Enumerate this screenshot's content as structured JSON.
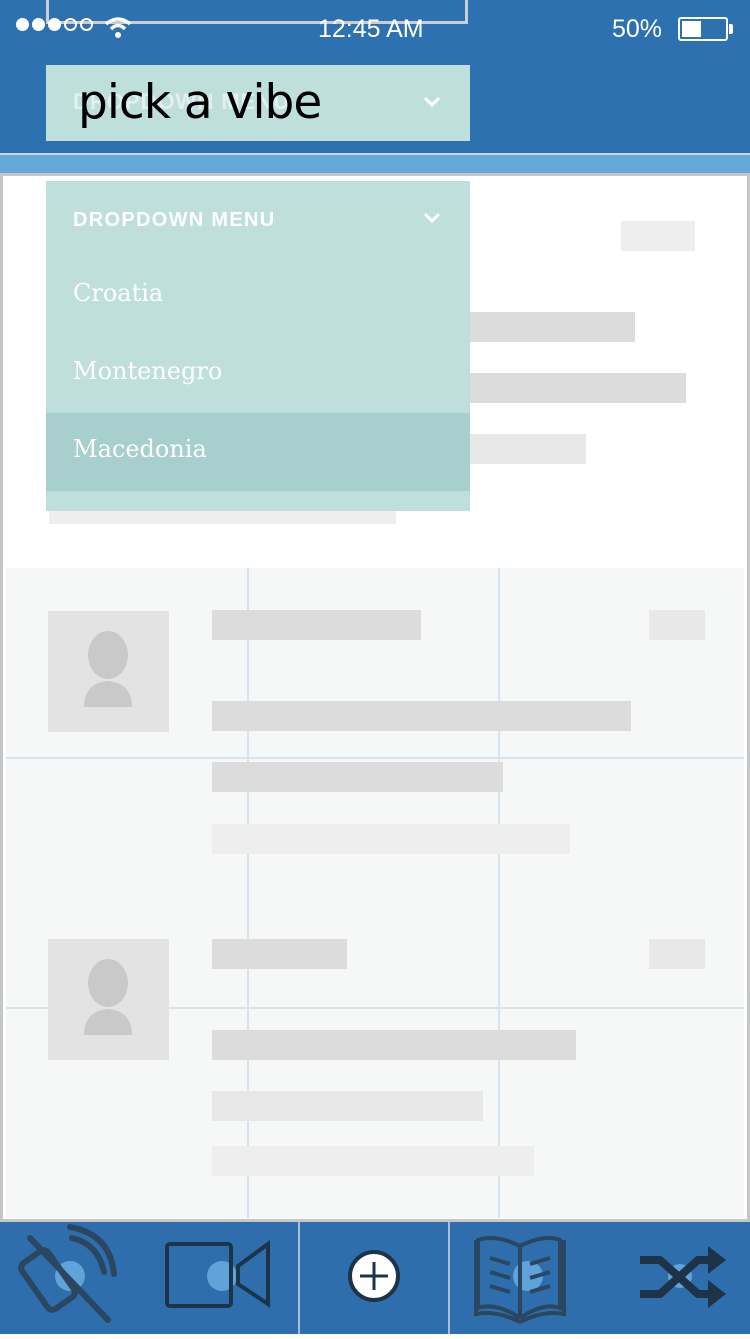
{
  "status_bar": {
    "time": "12:45 AM",
    "battery_percent": "50%",
    "battery_level": 0.45,
    "signal_bars_filled": 3,
    "signal_bars_total": 5
  },
  "header": {
    "select_ghost_label": "DROPDOWN MENU",
    "select_label": "pick a vibe"
  },
  "dropdown": {
    "header_label": "DROPDOWN MENU",
    "options": [
      {
        "label": "Croatia",
        "selected": false
      },
      {
        "label": "Montenegro",
        "selected": false
      },
      {
        "label": "Macedonia",
        "selected": true
      }
    ]
  },
  "tabbar": {
    "tabs": [
      {
        "icon": "satellite-phone-icon"
      },
      {
        "icon": "video-camera-icon"
      },
      {
        "icon": "add-circle-icon"
      },
      {
        "icon": "open-book-icon"
      },
      {
        "icon": "shuffle-icon"
      }
    ]
  },
  "colors": {
    "header_blue": "#2e71b0",
    "header_strip": "#64a8da",
    "dropdown_teal": "#bfdfdd",
    "dropdown_selected": "#a6cfcd",
    "tabbar_blue": "#2f6ead",
    "icon_accent": "#5fa3d8",
    "icon_dark": "#1d3347"
  }
}
